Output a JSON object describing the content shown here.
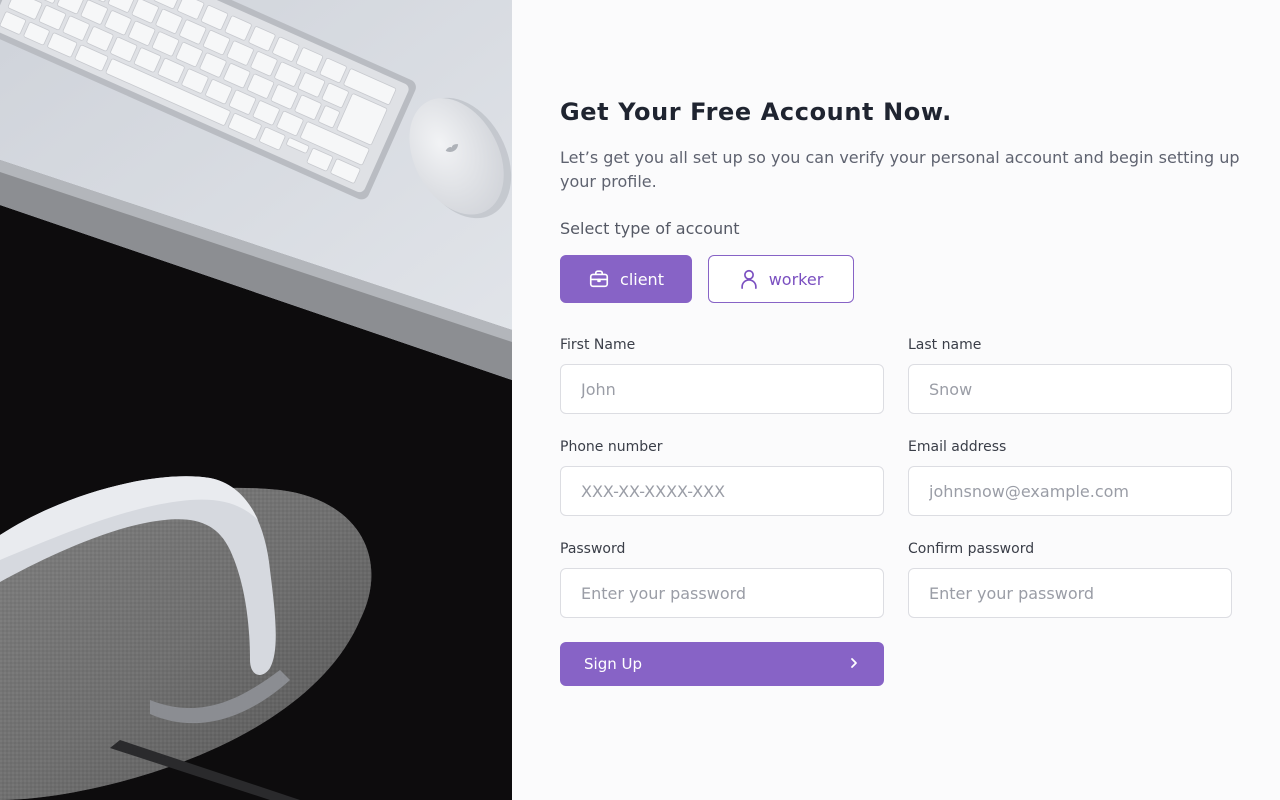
{
  "header": {
    "title": "Get Your Free Account Now.",
    "subtitle": "Let’s get you all set up so you can verify your personal account and begin setting up your profile."
  },
  "account_type": {
    "label": "Select type of account",
    "options": [
      {
        "label": "client",
        "icon": "briefcase-icon",
        "selected": true
      },
      {
        "label": "worker",
        "icon": "user-icon",
        "selected": false
      }
    ]
  },
  "form": {
    "first_name": {
      "label": "First Name",
      "placeholder": "John"
    },
    "last_name": {
      "label": "Last name",
      "placeholder": "Snow"
    },
    "phone": {
      "label": "Phone number",
      "placeholder": "XXX-XX-XXXX-XXX"
    },
    "email": {
      "label": "Email address",
      "placeholder": "johnsnow@example.com"
    },
    "password": {
      "label": "Password",
      "placeholder": "Enter your password"
    },
    "confirm_password": {
      "label": "Confirm password",
      "placeholder": "Enter your password"
    }
  },
  "submit": {
    "label": "Sign Up",
    "icon": "chevron-right-icon"
  },
  "colors": {
    "accent": "#8763c6",
    "background": "#fbfbfc",
    "text": "#1f2430"
  }
}
